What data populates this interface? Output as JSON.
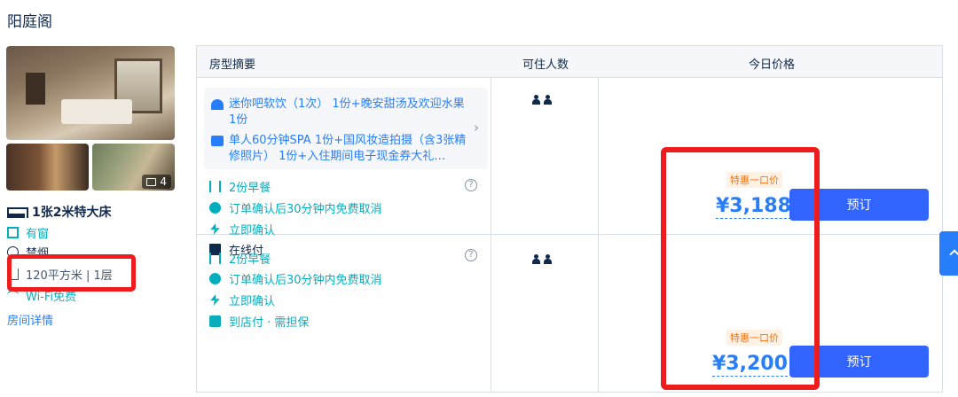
{
  "hotel": {
    "name": "阳庭阁"
  },
  "gallery": {
    "photo_count": "4"
  },
  "room": {
    "bed": "1张2米特大床",
    "features": {
      "window": "有窗",
      "smoking": "禁烟",
      "area": "120平方米 | 1层",
      "wifi": "Wi-Fi免费"
    },
    "detail_link": "房间详情"
  },
  "table": {
    "headers": {
      "summary": "房型摘要",
      "capacity": "可住人数",
      "price": "今日价格"
    }
  },
  "offers": [
    {
      "package_line1": "迷你吧软饮（1次） 1份+晚安甜汤及欢迎水果 1份",
      "package_line2": "单人60分钟SPA 1份+国风妆造拍摄（含3张精修照片） 1份+入住期间电子现金券大礼…",
      "breakfast": "2份早餐",
      "cancel": "订单确认后30分钟内免费取消",
      "confirm": "立即确认",
      "payment": "在线付",
      "promo_label": "特惠一口价",
      "price": "¥3,188",
      "book_label": "预订"
    },
    {
      "breakfast": "2份早餐",
      "cancel": "订单确认后30分钟内免费取消",
      "confirm": "立即确认",
      "payment": "到店付 · 需担保",
      "promo_label": "特惠一口价",
      "price": "¥3,200",
      "book_label": "预订"
    }
  ],
  "colors": {
    "accent": "#287dfa",
    "button": "#3264ff",
    "policy": "#06aebd",
    "highlight": "#ee1c1c",
    "promo": "#ff6f00"
  }
}
